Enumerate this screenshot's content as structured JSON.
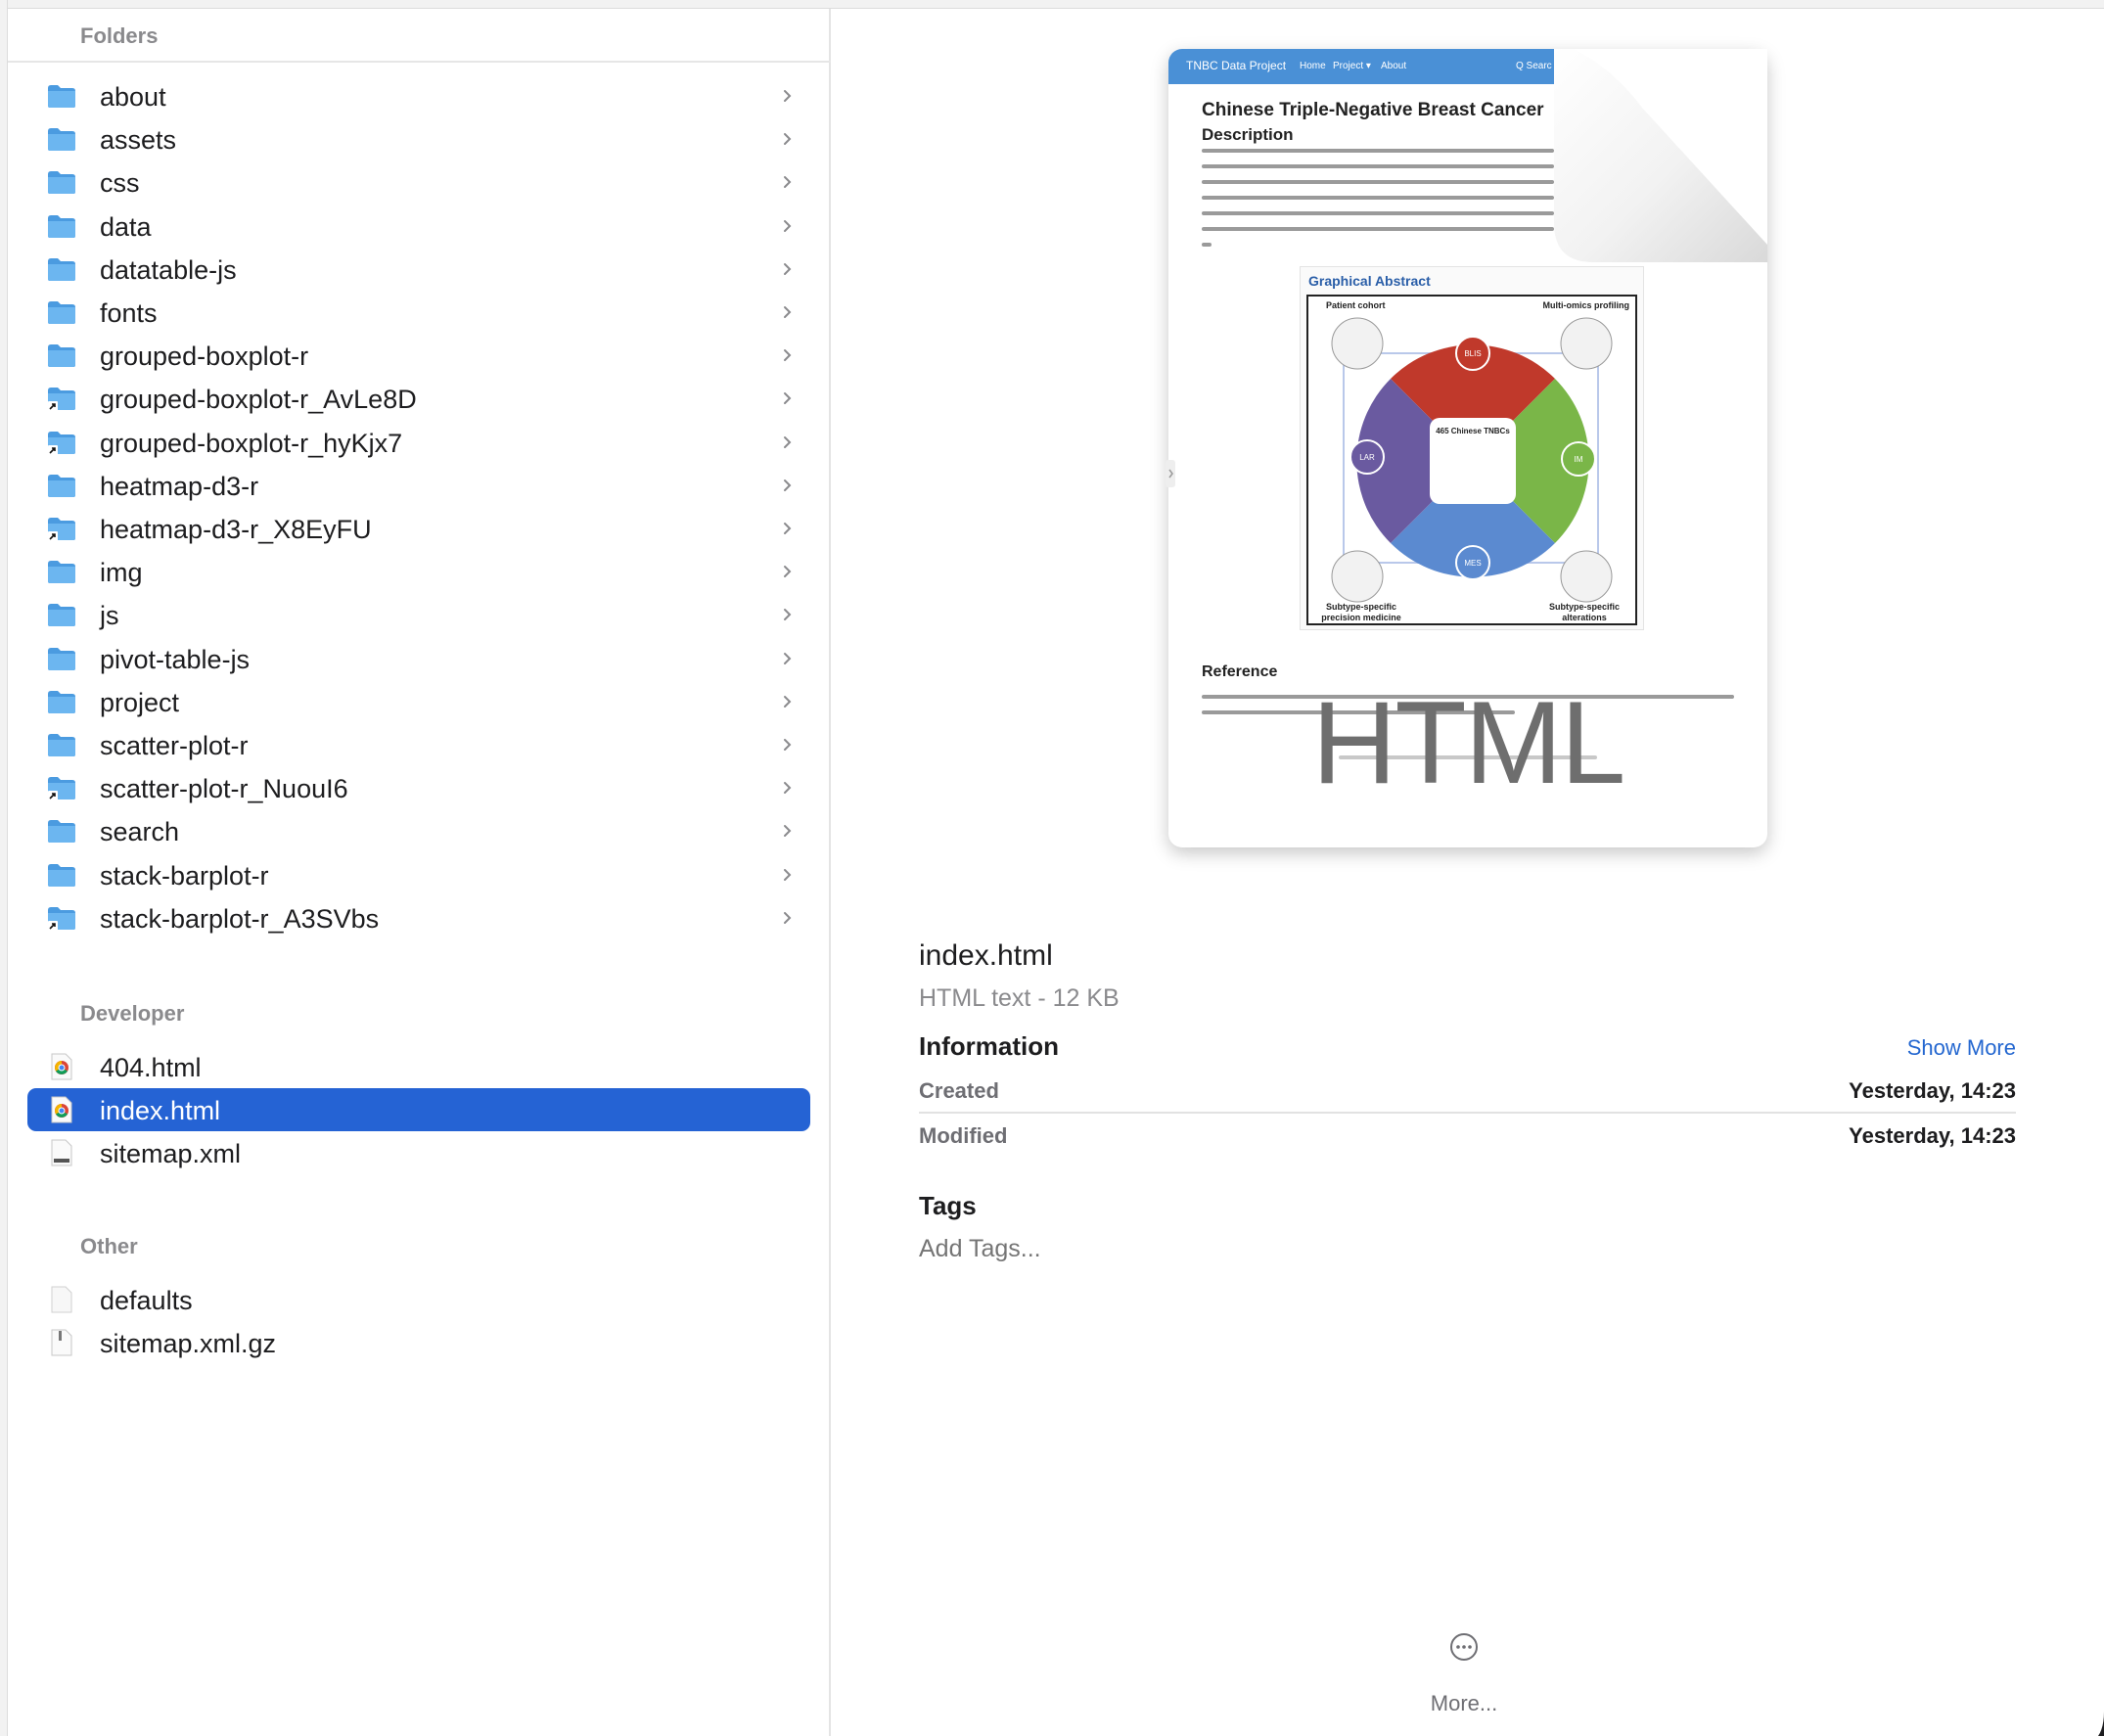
{
  "sections": {
    "folders": {
      "title": "Folders"
    },
    "developer": {
      "title": "Developer"
    },
    "other": {
      "title": "Other"
    }
  },
  "folders": [
    {
      "name": "about",
      "alias": false
    },
    {
      "name": "assets",
      "alias": false
    },
    {
      "name": "css",
      "alias": false
    },
    {
      "name": "data",
      "alias": false
    },
    {
      "name": "datatable-js",
      "alias": false
    },
    {
      "name": "fonts",
      "alias": false
    },
    {
      "name": "grouped-boxplot-r",
      "alias": false
    },
    {
      "name": "grouped-boxplot-r_AvLe8D",
      "alias": true
    },
    {
      "name": "grouped-boxplot-r_hyKjx7",
      "alias": true
    },
    {
      "name": "heatmap-d3-r",
      "alias": false
    },
    {
      "name": "heatmap-d3-r_X8EyFU",
      "alias": true
    },
    {
      "name": "img",
      "alias": false
    },
    {
      "name": "js",
      "alias": false
    },
    {
      "name": "pivot-table-js",
      "alias": false
    },
    {
      "name": "project",
      "alias": false
    },
    {
      "name": "scatter-plot-r",
      "alias": false
    },
    {
      "name": "scatter-plot-r_NuouI6",
      "alias": true
    },
    {
      "name": "search",
      "alias": false
    },
    {
      "name": "stack-barplot-r",
      "alias": false
    },
    {
      "name": "stack-barplot-r_A3SVbs",
      "alias": true
    }
  ],
  "developer_files": [
    {
      "name": "404.html",
      "icon": "chrome-html-icon",
      "selected": false
    },
    {
      "name": "index.html",
      "icon": "chrome-html-icon",
      "selected": true
    },
    {
      "name": "sitemap.xml",
      "icon": "xml-file-icon",
      "selected": false
    }
  ],
  "other_files": [
    {
      "name": "defaults",
      "icon": "blank-file-icon"
    },
    {
      "name": "sitemap.xml.gz",
      "icon": "archive-file-icon"
    }
  ],
  "preview": {
    "nav_brand": "TNBC Data Project",
    "nav_home": "Home",
    "nav_project": "Project ▾",
    "nav_about": "About",
    "nav_search": "Q Searc",
    "heading": "Chinese Triple-Negative Breast Cancer",
    "description": "Description",
    "abstract_title": "Graphical Abstract",
    "abstract_labels": {
      "tl": "Patient cohort",
      "tr": "Multi-omics profiling",
      "bl1": "Subtype-specific",
      "bl2": "precision medicine",
      "br1": "Subtype-specific",
      "br2": "alterations",
      "center": "465 Chinese TNBCs",
      "blis": "BLIS",
      "lar": "LAR",
      "im": "IM",
      "mes": "MES"
    },
    "reference": "Reference",
    "badge": "HTML"
  },
  "file": {
    "name": "index.html",
    "kind": "HTML text - 12 KB"
  },
  "information": {
    "title": "Information",
    "show_more": "Show More",
    "created_label": "Created",
    "created_value": "Yesterday, 14:23",
    "modified_label": "Modified",
    "modified_value": "Yesterday, 14:23"
  },
  "tags": {
    "title": "Tags",
    "placeholder": "Add Tags..."
  },
  "more": {
    "label": "More..."
  },
  "colors": {
    "selection": "#2563d4",
    "folder": "#5aa9e6",
    "link": "#2467d0"
  }
}
